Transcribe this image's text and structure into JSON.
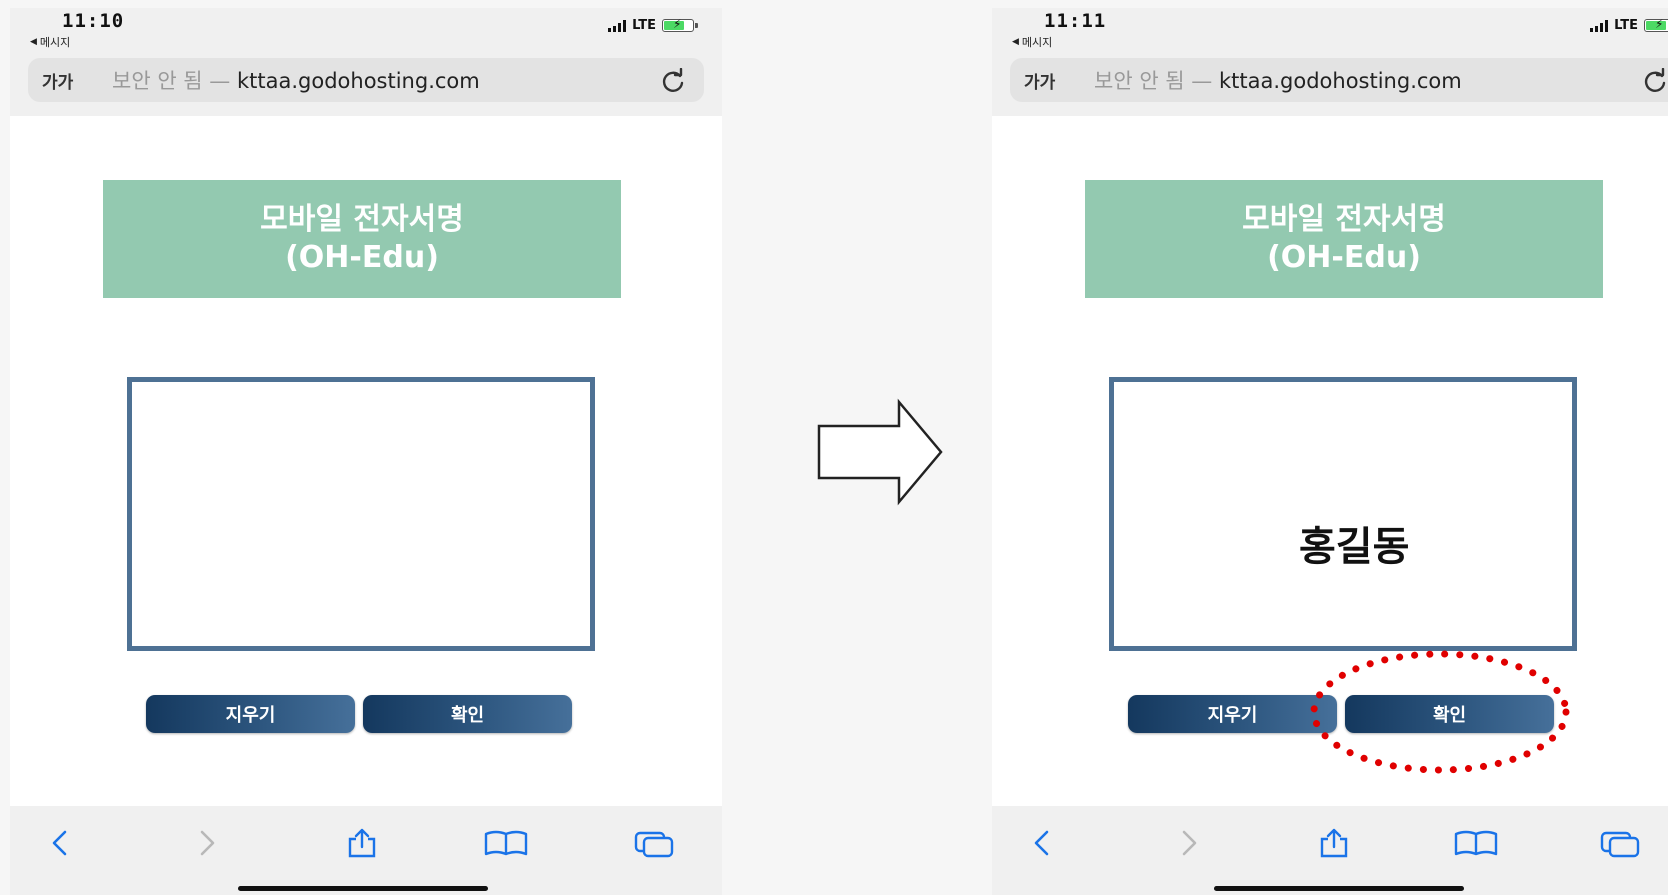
{
  "left": {
    "status": {
      "time": "11:10",
      "back_label": "메시지",
      "network": "LTE"
    },
    "url": {
      "aa": "가가",
      "warning": "보안 안 됨 — ",
      "host": "kttaa.godohosting.com"
    },
    "banner": {
      "line1": "모바일 전자서명",
      "line2": "(OH-Edu)"
    },
    "signature": "",
    "buttons": {
      "clear": "지우기",
      "confirm": "확인"
    }
  },
  "right": {
    "status": {
      "time": "11:11",
      "back_label": "메시지",
      "network": "LTE"
    },
    "url": {
      "aa": "가가",
      "warning": "보안 안 됨 — ",
      "host": "kttaa.godohosting.com"
    },
    "banner": {
      "line1": "모바일 전자서명",
      "line2": "(OH-Edu)"
    },
    "signature": "홍길동",
    "buttons": {
      "clear": "지우기",
      "confirm": "확인"
    }
  },
  "colors": {
    "banner": "#93c9b0",
    "pad_border": "#4e7194",
    "button": "#1f4870",
    "toolbar_icon": "#1a73e8",
    "highlight": "#e00000"
  },
  "icons": [
    "reload-icon",
    "back-icon",
    "forward-icon",
    "share-icon",
    "bookmarks-icon",
    "tabs-icon",
    "right-arrow-icon"
  ]
}
